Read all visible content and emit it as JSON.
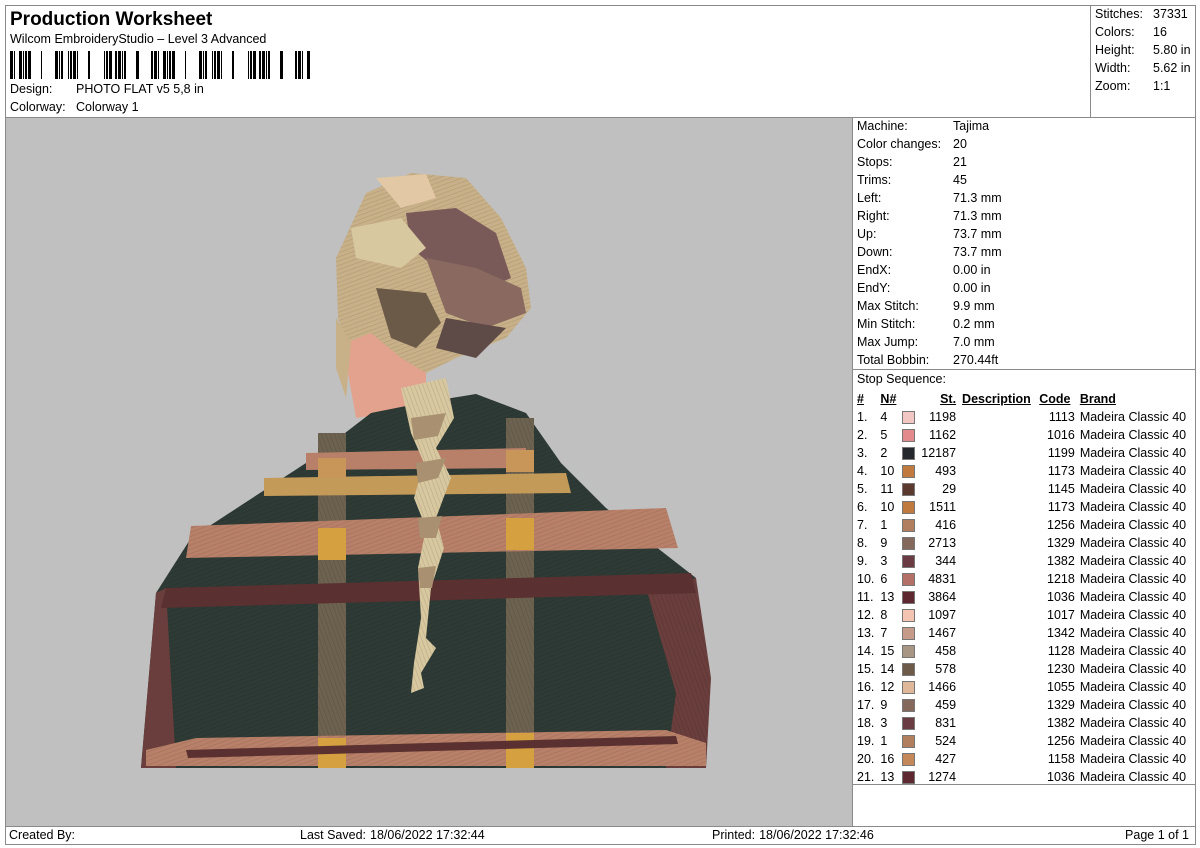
{
  "header": {
    "title": "Production Worksheet",
    "software": "Wilcom EmbroideryStudio – Level 3 Advanced",
    "design_label": "Design:",
    "design_value": "PHOTO FLAT v5 5,8 in",
    "colorway_label": "Colorway:",
    "colorway_value": "Colorway 1"
  },
  "summary": {
    "stitches_label": "Stitches:",
    "stitches": "37331",
    "colors_label": "Colors:",
    "colors": "16",
    "height_label": "Height:",
    "height": "5.80 in",
    "width_label": "Width:",
    "width": "5.62 in",
    "zoom_label": "Zoom:",
    "zoom": "1:1"
  },
  "machine": [
    {
      "label": "Machine:",
      "value": "Tajima"
    },
    {
      "label": "Color changes:",
      "value": "20"
    },
    {
      "label": "Stops:",
      "value": "21"
    },
    {
      "label": "Trims:",
      "value": "45"
    },
    {
      "label": "Left:",
      "value": "71.3 mm"
    },
    {
      "label": "Right:",
      "value": "71.3 mm"
    },
    {
      "label": "Up:",
      "value": "73.7 mm"
    },
    {
      "label": "Down:",
      "value": "73.7 mm"
    },
    {
      "label": "EndX:",
      "value": "0.00 in"
    },
    {
      "label": "EndY:",
      "value": "0.00 in"
    },
    {
      "label": "Max Stitch:",
      "value": "9.9 mm"
    },
    {
      "label": "Min Stitch:",
      "value": "0.2 mm"
    },
    {
      "label": "Max Jump:",
      "value": "7.0 mm"
    },
    {
      "label": "Total Bobbin:",
      "value": "270.44ft"
    }
  ],
  "stop_sequence": {
    "title": "Stop Sequence:",
    "columns": [
      "#",
      "N#",
      "St.",
      "Description",
      "Code",
      "Brand"
    ],
    "rows": [
      {
        "idx": "1.",
        "n": "4",
        "color": "#f2c6c2",
        "st": "1198",
        "code": "1113",
        "brand": "Madeira Classic 40"
      },
      {
        "idx": "2.",
        "n": "5",
        "color": "#e38a8c",
        "st": "1162",
        "code": "1016",
        "brand": "Madeira Classic 40"
      },
      {
        "idx": "3.",
        "n": "2",
        "color": "#25292e",
        "st": "12187",
        "code": "1199",
        "brand": "Madeira Classic 40"
      },
      {
        "idx": "4.",
        "n": "10",
        "color": "#c07a3e",
        "st": "493",
        "code": "1173",
        "brand": "Madeira Classic 40"
      },
      {
        "idx": "5.",
        "n": "11",
        "color": "#5a3a2e",
        "st": "29",
        "code": "1145",
        "brand": "Madeira Classic 40"
      },
      {
        "idx": "6.",
        "n": "10",
        "color": "#c07a3e",
        "st": "1511",
        "code": "1173",
        "brand": "Madeira Classic 40"
      },
      {
        "idx": "7.",
        "n": "1",
        "color": "#b27f5e",
        "st": "416",
        "code": "1256",
        "brand": "Madeira Classic 40"
      },
      {
        "idx": "8.",
        "n": "9",
        "color": "#84685c",
        "st": "2713",
        "code": "1329",
        "brand": "Madeira Classic 40"
      },
      {
        "idx": "9.",
        "n": "3",
        "color": "#6b3b44",
        "st": "344",
        "code": "1382",
        "brand": "Madeira Classic 40"
      },
      {
        "idx": "10.",
        "n": "6",
        "color": "#b47066",
        "st": "4831",
        "code": "1218",
        "brand": "Madeira Classic 40"
      },
      {
        "idx": "11.",
        "n": "13",
        "color": "#5e2830",
        "st": "3864",
        "code": "1036",
        "brand": "Madeira Classic 40"
      },
      {
        "idx": "12.",
        "n": "8",
        "color": "#f4c4b2",
        "st": "1097",
        "code": "1017",
        "brand": "Madeira Classic 40"
      },
      {
        "idx": "13.",
        "n": "7",
        "color": "#c69a88",
        "st": "1467",
        "code": "1342",
        "brand": "Madeira Classic 40"
      },
      {
        "idx": "14.",
        "n": "15",
        "color": "#a89684",
        "st": "458",
        "code": "1128",
        "brand": "Madeira Classic 40"
      },
      {
        "idx": "15.",
        "n": "14",
        "color": "#6e5a48",
        "st": "578",
        "code": "1230",
        "brand": "Madeira Classic 40"
      },
      {
        "idx": "16.",
        "n": "12",
        "color": "#deb898",
        "st": "1466",
        "code": "1055",
        "brand": "Madeira Classic 40"
      },
      {
        "idx": "17.",
        "n": "9",
        "color": "#84685c",
        "st": "459",
        "code": "1329",
        "brand": "Madeira Classic 40"
      },
      {
        "idx": "18.",
        "n": "3",
        "color": "#6b3b44",
        "st": "831",
        "code": "1382",
        "brand": "Madeira Classic 40"
      },
      {
        "idx": "19.",
        "n": "1",
        "color": "#b27f5e",
        "st": "524",
        "code": "1256",
        "brand": "Madeira Classic 40"
      },
      {
        "idx": "20.",
        "n": "16",
        "color": "#c48858",
        "st": "427",
        "code": "1158",
        "brand": "Madeira Classic 40"
      },
      {
        "idx": "21.",
        "n": "13",
        "color": "#5e2830",
        "st": "1274",
        "code": "1036",
        "brand": "Madeira Classic 40"
      }
    ]
  },
  "footer": {
    "created_label": "Created By:",
    "created_value": "",
    "saved_label": "Last Saved:",
    "saved_value": "18/06/2022 17:32:44",
    "printed_label": "Printed:",
    "printed_value": "18/06/2022 17:32:46",
    "page": "Page 1 of 1"
  }
}
